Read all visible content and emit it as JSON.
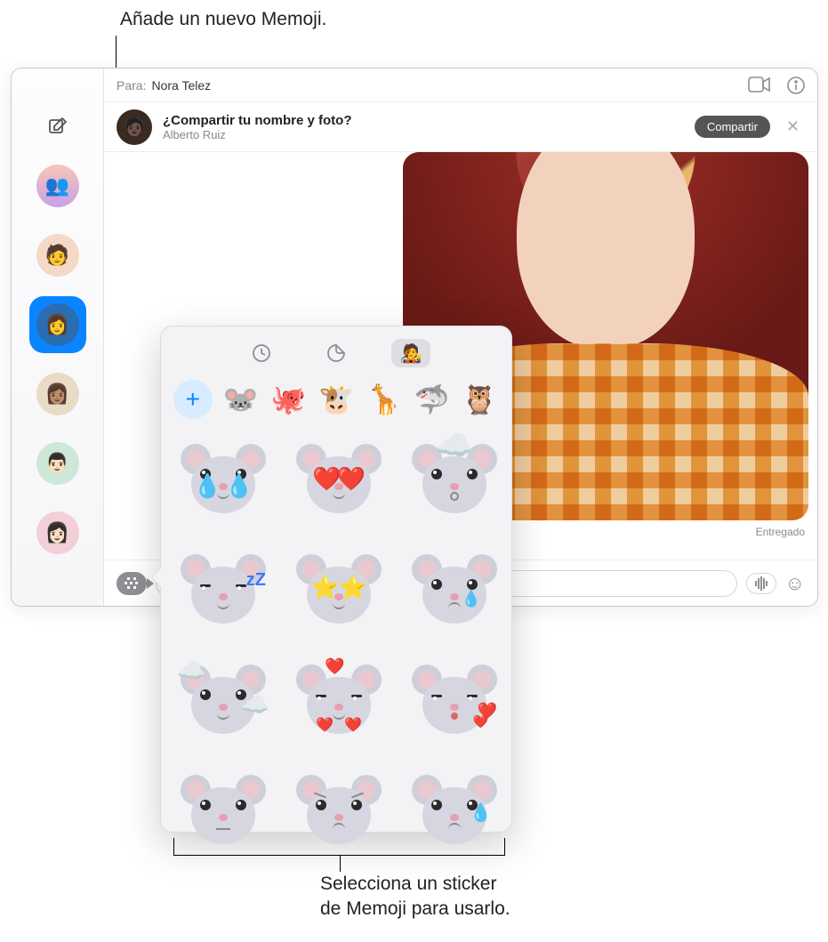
{
  "annotations": {
    "top": "Añade un nuevo Memoji.",
    "bottom_line1": "Selecciona un sticker",
    "bottom_line2": "de Memoji para usarlo."
  },
  "window": {
    "to_label": "Para:",
    "to_name": "Nora Telez"
  },
  "share_banner": {
    "question": "¿Compartir tu nombre y foto?",
    "name": "Alberto Ruiz",
    "button": "Compartir"
  },
  "conversation": {
    "delivered_label": "Entregado"
  },
  "compose": {
    "placeholder": ""
  },
  "popover": {
    "tabs": [
      "recents",
      "stickers",
      "memoji"
    ],
    "characters": [
      "mouse",
      "octopus",
      "cow",
      "giraffe",
      "shark",
      "owl"
    ],
    "sticker_variants": [
      "laugh-cry",
      "heart-eyes",
      "mind-blown",
      "sleepy",
      "star-eyes",
      "tear",
      "head-in-clouds",
      "hearts-around",
      "kiss-hearts",
      "neutral",
      "angry",
      "sweat"
    ]
  },
  "colors": {
    "accent": "#0A84FF",
    "sidebar_selected": "#0A84FF",
    "popover_bg": "#f3f3f5"
  }
}
